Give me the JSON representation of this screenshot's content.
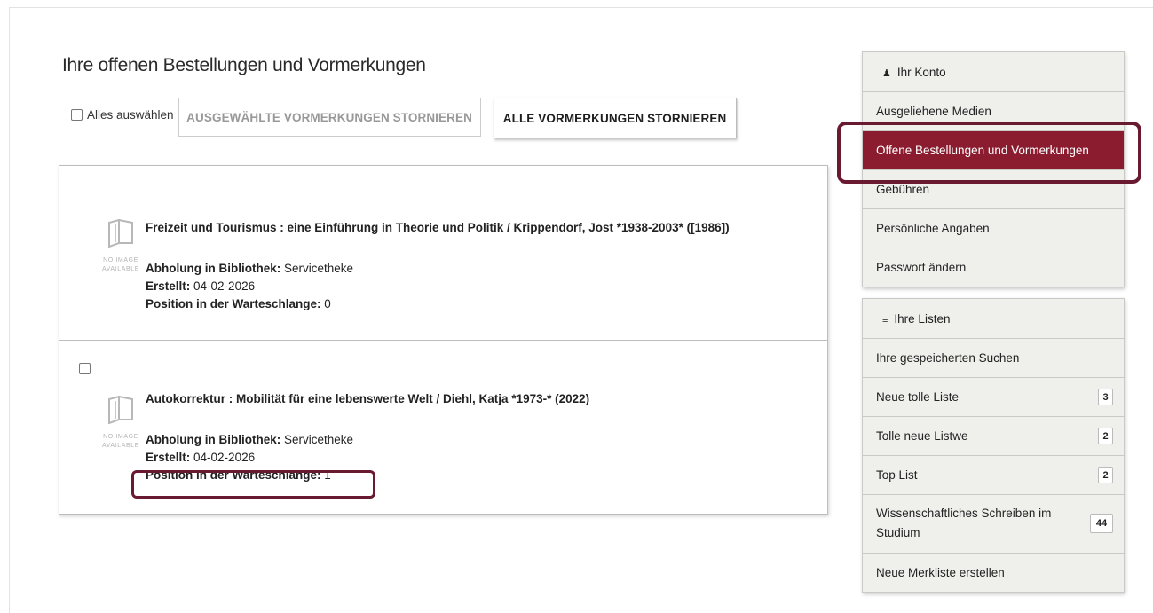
{
  "page": {
    "heading": "Ihre offenen Bestellungen und Vormerkungen"
  },
  "toolbar": {
    "select_all_label": "Alles auswählen",
    "cancel_selected_label": "Ausgewählte Vormerkungen stornieren",
    "cancel_all_label": "Alle Vormerkungen stornieren"
  },
  "orders": [
    {
      "title": "Freizeit und Tourismus : eine Einführung in Theorie und Politik / Krippendorf, Jost *1938-2003* ([1986])",
      "cover_text_line1": "NO IMAGE",
      "cover_text_line2": "AVAILABLE",
      "pickup_label": "Abholung in Bibliothek:",
      "pickup_value": "Servicetheke",
      "created_label": "Erstellt:",
      "created_value": "04-02-2026",
      "queue_label": "Position in der Warteschlange:",
      "queue_value": "0",
      "has_checkbox": false
    },
    {
      "title": "Autokorrektur : Mobilität für eine lebenswerte Welt / Diehl, Katja *1973-* (2022)",
      "cover_text_line1": "NO IMAGE",
      "cover_text_line2": "AVAILABLE",
      "pickup_label": "Abholung in Bibliothek:",
      "pickup_value": "Servicetheke",
      "created_label": "Erstellt:",
      "created_value": "04-02-2026",
      "queue_label": "Position in der Warteschlange:",
      "queue_value": "1",
      "has_checkbox": true
    }
  ],
  "account_panel": {
    "header": "Ihr Konto",
    "header_icon": "user-icon",
    "items": [
      {
        "label": "Ausgeliehene Medien"
      },
      {
        "label": "Offene Bestellungen und Vormerkungen",
        "active": true
      },
      {
        "label": "Gebühren"
      },
      {
        "label": "Persönliche Angaben"
      },
      {
        "label": "Passwort ändern"
      }
    ]
  },
  "lists_panel": {
    "header": "Ihre Listen",
    "header_icon": "list-icon",
    "items": [
      {
        "label": "Ihre gespeicherten Suchen"
      },
      {
        "label": "Neue tolle Liste",
        "count": "3"
      },
      {
        "label": "Tolle neue Listwe",
        "count": "2"
      },
      {
        "label": "Top List",
        "count": "2"
      },
      {
        "label": "Wissenschaftliches Schreiben im Studium",
        "count": "44"
      },
      {
        "label": "Neue Merkliste erstellen"
      }
    ]
  },
  "colors": {
    "active_background": "#8b1c2f",
    "highlight_border": "#6a1a30",
    "panel_background": "#efefec"
  }
}
